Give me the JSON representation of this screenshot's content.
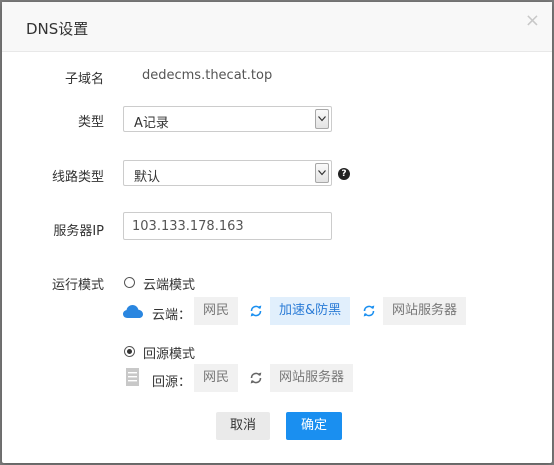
{
  "dialog": {
    "title": "DNS设置",
    "close_glyph": "×"
  },
  "form": {
    "subdomain": {
      "label": "子域名",
      "value": "dedecms.thecat.top"
    },
    "record_type": {
      "label": "类型",
      "value": "A记录"
    },
    "line_type": {
      "label": "线路类型",
      "value": "默认",
      "help_glyph": "?"
    },
    "server_ip": {
      "label": "服务器IP",
      "value": "103.133.178.163"
    },
    "run_mode": {
      "label": "运行模式",
      "cloud": {
        "option_label": "云端模式",
        "selected": false,
        "flow_label": "云端：",
        "steps": [
          "网民",
          "加速&防黑",
          "网站服务器"
        ],
        "active_step": "加速&防黑"
      },
      "origin": {
        "option_label": "回源模式",
        "selected": true,
        "flow_label": "回源：",
        "steps": [
          "网民",
          "网站服务器"
        ]
      }
    }
  },
  "buttons": {
    "cancel": "取消",
    "ok": "确定"
  },
  "colors": {
    "primary": "#1a8ff0",
    "cloud_icon": "#2a86e0",
    "active_chip_bg": "#e1effc"
  },
  "icons": {
    "cloud": "cloud-icon",
    "server": "server-icon",
    "refresh": "refresh-icon",
    "help": "question-circle-icon",
    "dropdown": "chevron-down-icon"
  }
}
